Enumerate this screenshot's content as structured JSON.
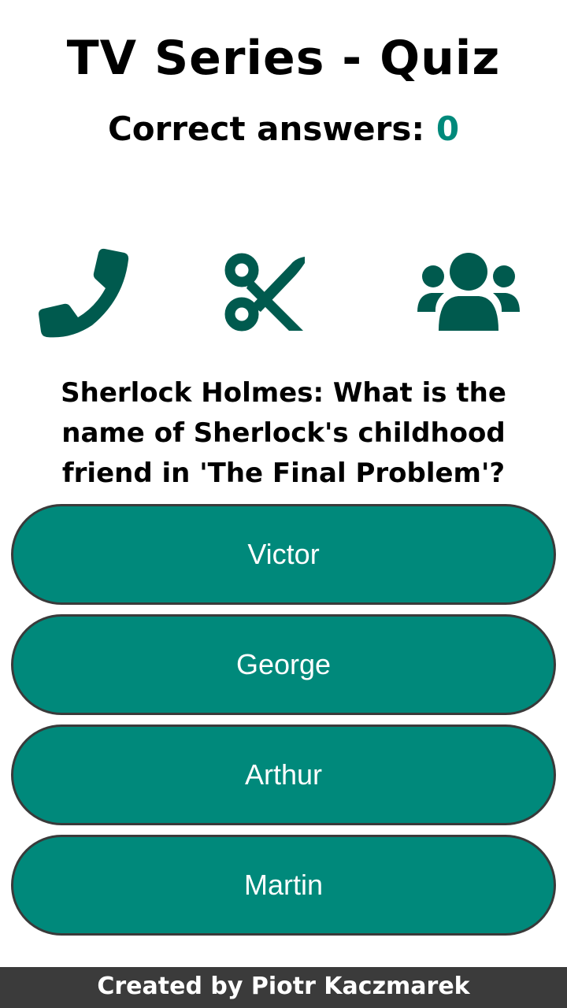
{
  "header": {
    "title": "TV Series - Quiz",
    "score_label": "Correct answers:",
    "score_value": "0"
  },
  "lifelines": [
    {
      "name": "phone-icon",
      "purpose": "phone a friend"
    },
    {
      "name": "scissors-icon",
      "purpose": "50:50"
    },
    {
      "name": "users-icon",
      "purpose": "ask the audience"
    }
  ],
  "question": {
    "text": "Sherlock Holmes: What is the name of Sherlock's childhood friend in 'The Final Problem'?"
  },
  "answers": [
    {
      "label": "Victor"
    },
    {
      "label": "George"
    },
    {
      "label": "Arthur"
    },
    {
      "label": "Martin"
    }
  ],
  "footer": {
    "credit": "Created by Piotr Kaczmarek"
  },
  "colors": {
    "accent": "#00897b",
    "icon": "#005a4e",
    "border": "#3a3a3a",
    "footer_bg": "#3b3b3b"
  }
}
